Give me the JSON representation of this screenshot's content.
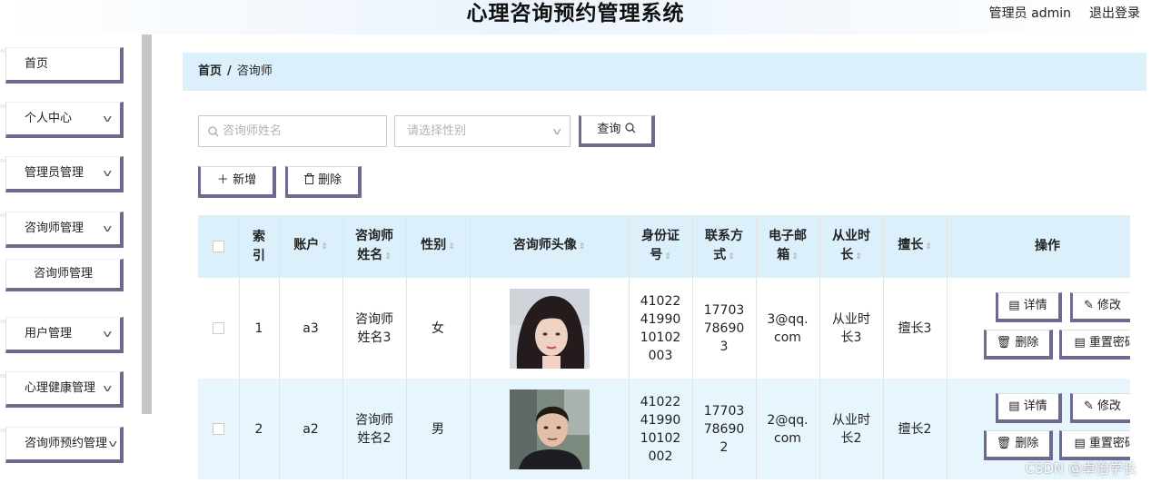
{
  "header": {
    "title": "心理咨询预约管理系统",
    "user": "管理员 admin",
    "logout": "退出登录"
  },
  "sidebar": {
    "items": [
      {
        "label": "首页",
        "has_chevron": false
      },
      {
        "label": "个人中心",
        "has_chevron": true
      },
      {
        "label": "管理员管理",
        "has_chevron": true
      },
      {
        "label": "咨询师管理",
        "has_chevron": true
      },
      {
        "label": "咨询师管理",
        "is_sub": true
      },
      {
        "label": "用户管理",
        "has_chevron": true
      },
      {
        "label": "心理健康管理",
        "has_chevron": true
      },
      {
        "label": "咨询师预约管理",
        "has_chevron": true
      }
    ]
  },
  "breadcrumb": {
    "home": "首页",
    "separator": "/",
    "current": "咨询师"
  },
  "search": {
    "name_placeholder": "咨询师姓名",
    "gender_placeholder": "请选择性别",
    "query_label": "查询"
  },
  "actions": {
    "add_label": "新增",
    "delete_label": "删除"
  },
  "table": {
    "headers": {
      "index": "索引",
      "account": "账户",
      "name": "咨询师姓名",
      "gender": "性别",
      "avatar": "咨询师头像",
      "id_card": "身份证号",
      "phone": "联系方式",
      "email": "电子邮箱",
      "years": "从业时长",
      "specialty": "擅长",
      "operations": "操作"
    },
    "rows": [
      {
        "index": "1",
        "account": "a3",
        "name": "咨询师姓名3",
        "gender": "女",
        "id_card": "410224199010102003",
        "phone": "17703786903",
        "email": "3@qq.com",
        "years": "从业时长3",
        "specialty": "擅长3"
      },
      {
        "index": "2",
        "account": "a2",
        "name": "咨询师姓名2",
        "gender": "男",
        "id_card": "410224199010102002",
        "phone": "17703786902",
        "email": "2@qq.com",
        "years": "从业时长2",
        "specialty": "擅长2"
      }
    ],
    "row_buttons": {
      "detail": "详情",
      "edit": "修改",
      "delete": "删除",
      "reset": "重置密码"
    }
  },
  "watermark": "CSDN @卓怡学长",
  "colors": {
    "accent_border": "#6d6a8f",
    "header_bg": "#dbf0fb",
    "row_alt_bg": "#e7f5fd"
  }
}
